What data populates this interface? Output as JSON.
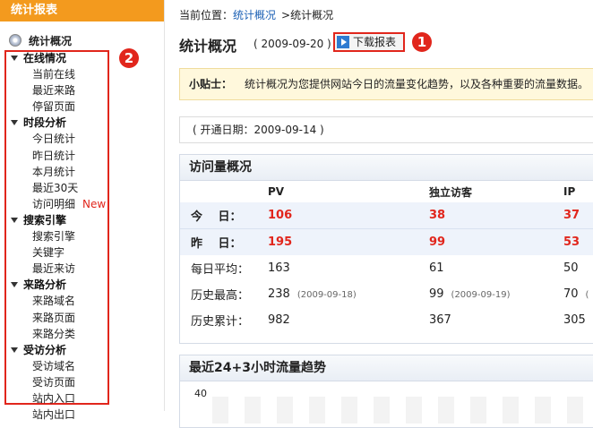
{
  "sidebar": {
    "header": "统计报表",
    "top_item": "统计概况",
    "badge": "2",
    "rows": [
      {
        "label": "在线情况",
        "type": "cat"
      },
      {
        "label": "当前在线",
        "type": "sub"
      },
      {
        "label": "最近来路",
        "type": "sub"
      },
      {
        "label": "停留页面",
        "type": "sub"
      },
      {
        "label": "时段分析",
        "type": "cat"
      },
      {
        "label": "今日统计",
        "type": "sub"
      },
      {
        "label": "昨日统计",
        "type": "sub"
      },
      {
        "label": "本月统计",
        "type": "sub"
      },
      {
        "label": "最近30天",
        "type": "sub"
      },
      {
        "label": "访问明细",
        "type": "sub",
        "tag": "New"
      },
      {
        "label": "搜索引擎",
        "type": "cat"
      },
      {
        "label": "搜索引擎",
        "type": "sub"
      },
      {
        "label": "关键字",
        "type": "sub"
      },
      {
        "label": "最近来访",
        "type": "sub"
      },
      {
        "label": "来路分析",
        "type": "cat"
      },
      {
        "label": "来路域名",
        "type": "sub"
      },
      {
        "label": "来路页面",
        "type": "sub"
      },
      {
        "label": "来路分类",
        "type": "sub"
      },
      {
        "label": "受访分析",
        "type": "cat"
      },
      {
        "label": "受访域名",
        "type": "sub"
      },
      {
        "label": "受访页面",
        "type": "sub"
      },
      {
        "label": "站内入口",
        "type": "sub"
      },
      {
        "label": "站内出口",
        "type": "sub"
      }
    ]
  },
  "breadcrumb": {
    "prefix": "当前位置：",
    "link": "统计概况",
    "current": ">统计概况"
  },
  "page": {
    "title": "统计概况",
    "date": "( 2009-09-20 )",
    "download_label": "下载报表",
    "badge": "1"
  },
  "tip": {
    "label": "小贴士：",
    "text": "统计概况为您提供网站今日的流量变化趋势，以及各种重要的流量数据。"
  },
  "open_date": "( 开通日期：2009-09-14 )",
  "visits": {
    "title": "访问量概况",
    "headers": [
      "PV",
      "独立访客",
      "IP"
    ],
    "rows": [
      {
        "label": "今　 日：",
        "pv": "106",
        "uv": "38",
        "ip": "37",
        "style": "today"
      },
      {
        "label": "昨　 日：",
        "pv": "195",
        "uv": "99",
        "ip": "53",
        "style": "yest"
      },
      {
        "label": "每日平均：",
        "pv": "163",
        "uv": "61",
        "ip": "50",
        "style": "plain"
      },
      {
        "label": "历史最高：",
        "pv": "238",
        "pv_date": "(2009-09-18)",
        "uv": "99",
        "uv_date": "(2009-09-19)",
        "ip": "70",
        "ip_date": "(",
        "style": "plain"
      },
      {
        "label": "历史累计：",
        "pv": "982",
        "uv": "367",
        "ip": "305",
        "style": "plain"
      }
    ]
  },
  "trend": {
    "title": "最近24+3小时流量趋势",
    "axis_top": "40"
  },
  "colors": {
    "accent": "#f39a1e",
    "highlight": "#e1261c",
    "link": "#1a5fb4"
  }
}
